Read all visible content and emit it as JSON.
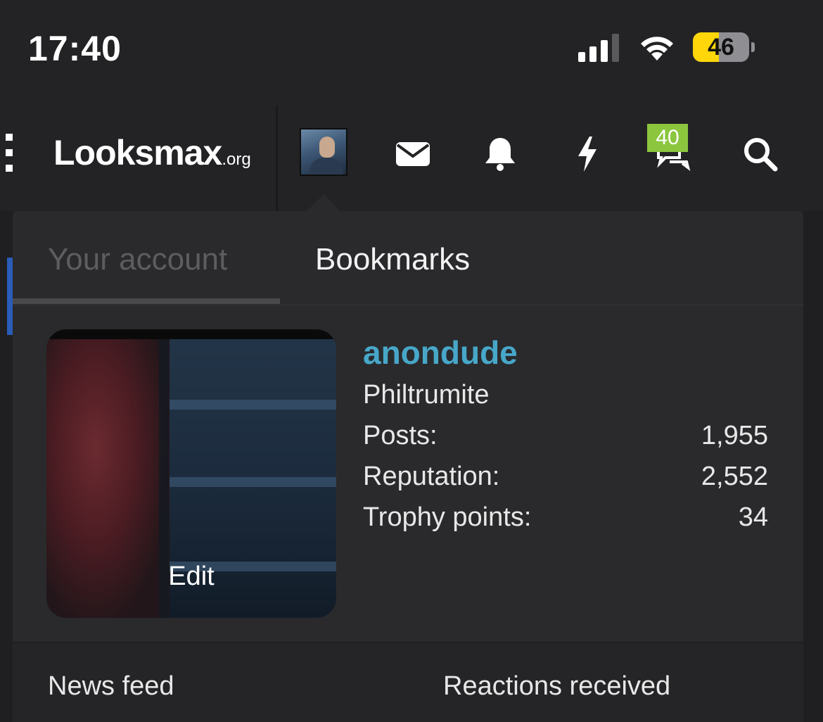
{
  "status_bar": {
    "time": "17:40",
    "battery_level": "46",
    "battery_percent": 46,
    "signal_icon": "cellular-signal-icon",
    "wifi_icon": "wifi-icon"
  },
  "header": {
    "logo_text": "Looksmax",
    "logo_suffix": ".org",
    "menu_icon": "menu-icon",
    "icons": [
      "envelope-icon",
      "bell-icon",
      "lightning-icon",
      "chat-bubbles-icon",
      "search-icon"
    ],
    "chat_badge": "40",
    "badge_color": "#8cc63f"
  },
  "tabs": {
    "account": "Your account",
    "bookmarks": "Bookmarks"
  },
  "profile": {
    "username": "anondude",
    "username_color": "#47a7c9",
    "user_title": "Philtrumite",
    "edit_label": "Edit",
    "stats": [
      {
        "label": "Posts:",
        "value": "1,955"
      },
      {
        "label": "Reputation:",
        "value": "2,552"
      },
      {
        "label": "Trophy points:",
        "value": "34"
      }
    ]
  },
  "links": {
    "news_feed": "News feed",
    "reactions_received": "Reactions received"
  }
}
